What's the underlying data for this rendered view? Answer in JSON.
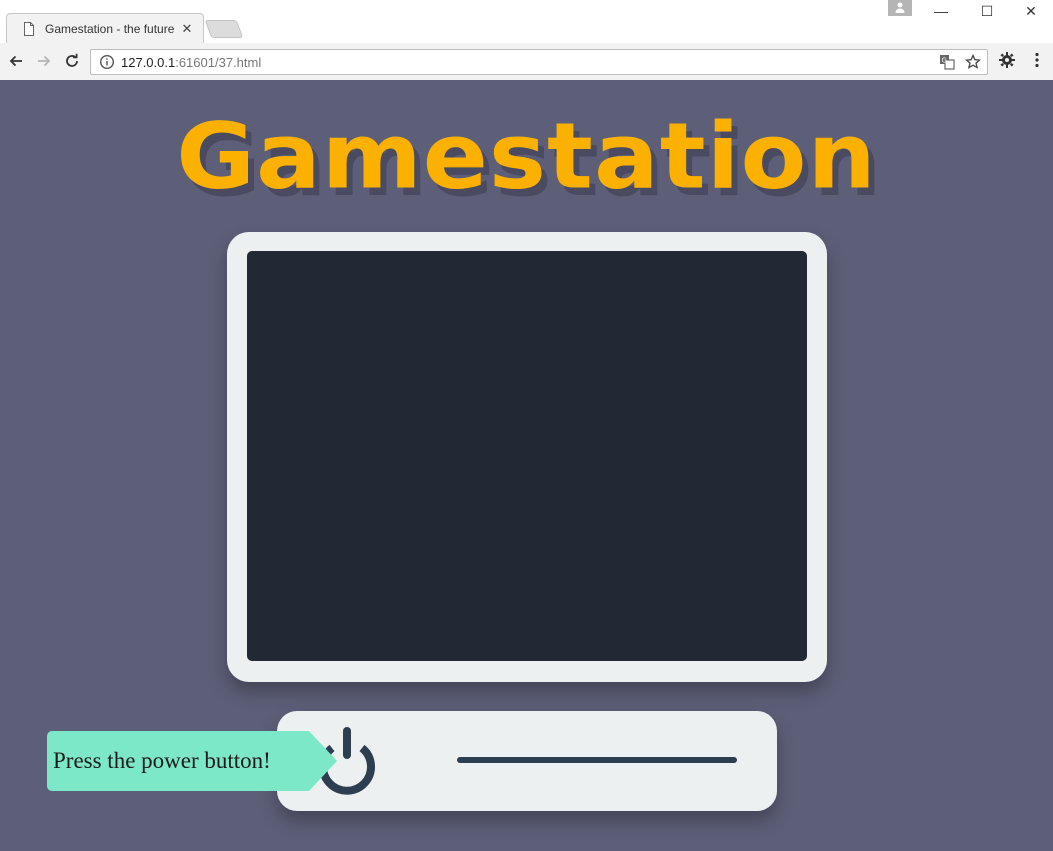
{
  "browser": {
    "tab_title": "Gamestation - the future",
    "tab_close": "✕",
    "url_host": "127.0.0.1",
    "url_rest": ":61601/37.html",
    "window_minimize": "—",
    "window_maximize": "☐",
    "window_close": "✕"
  },
  "page": {
    "logo": "Gamestation",
    "tooltip": "Press the power button!"
  },
  "colors": {
    "background": "#5d5f78",
    "logo": "#fcb000",
    "monitor_frame": "#ecf0f1",
    "screen": "#222834",
    "power_icon": "#2c3e50",
    "tooltip": "#7de8c8"
  },
  "icons": {
    "tab": "document-icon",
    "back": "back-arrow-icon",
    "forward": "forward-arrow-icon",
    "reload": "reload-icon",
    "site_info": "info-icon",
    "translate": "translate-icon",
    "bookmark": "star-icon",
    "extension": "gear-icon",
    "menu": "kebab-menu-icon",
    "power": "power-icon"
  }
}
